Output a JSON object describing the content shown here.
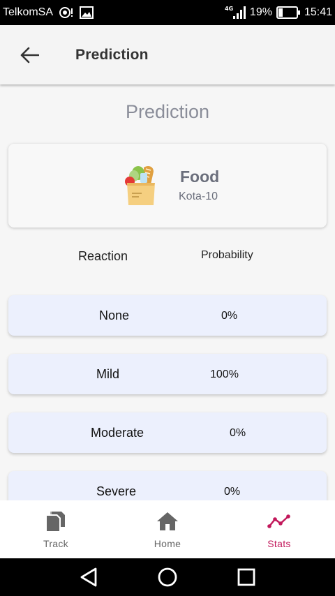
{
  "status_bar": {
    "carrier": "TelkomSA",
    "network": "4G",
    "battery": "19%",
    "time": "15:41"
  },
  "app_bar": {
    "title": "Prediction",
    "back_icon": "arrow-left-icon"
  },
  "main": {
    "heading": "Prediction",
    "food": {
      "name": "Food",
      "code": "Kota-10",
      "icon": "grocery-bag-icon"
    },
    "table": {
      "headers": {
        "reaction": "Reaction",
        "probability": "Probability"
      },
      "rows": [
        {
          "reaction": "None",
          "probability": "0%"
        },
        {
          "reaction": "Mild",
          "probability": "100%"
        },
        {
          "reaction": "Moderate",
          "probability": "0%"
        },
        {
          "reaction": "Severe",
          "probability": "0%"
        }
      ]
    }
  },
  "bottom_nav": {
    "items": [
      {
        "label": "Track",
        "icon": "documents-icon",
        "active": false
      },
      {
        "label": "Home",
        "icon": "home-icon",
        "active": false
      },
      {
        "label": "Stats",
        "icon": "trend-line-icon",
        "active": true
      }
    ],
    "active_color": "#c2185b",
    "inactive_color": "#666666"
  },
  "colors": {
    "row_bg": "#ecf0fd",
    "heading": "#8a8d99"
  }
}
